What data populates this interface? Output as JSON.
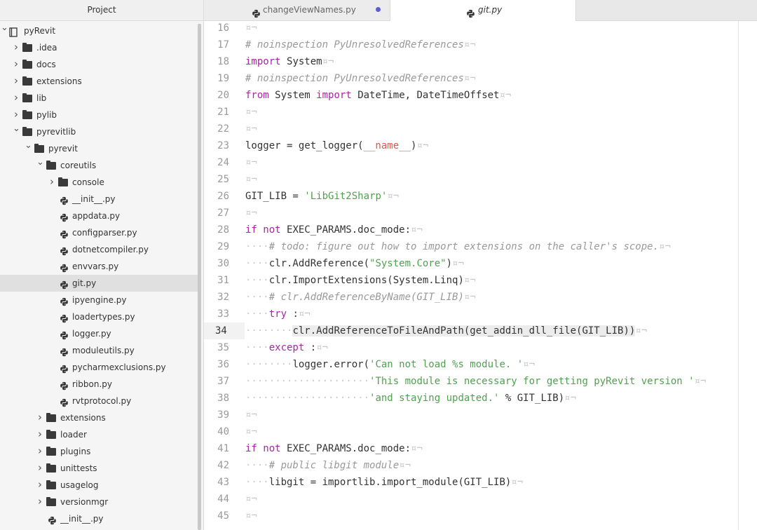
{
  "panel": {
    "title": "Project"
  },
  "tree": [
    {
      "label": "pyRevit",
      "type": "root",
      "depth": 0,
      "arrow": "open"
    },
    {
      "label": ".idea",
      "type": "folder",
      "depth": 1,
      "arrow": "closed"
    },
    {
      "label": "docs",
      "type": "folder",
      "depth": 1,
      "arrow": "closed"
    },
    {
      "label": "extensions",
      "type": "folder",
      "depth": 1,
      "arrow": "closed"
    },
    {
      "label": "lib",
      "type": "folder",
      "depth": 1,
      "arrow": "closed"
    },
    {
      "label": "pylib",
      "type": "folder",
      "depth": 1,
      "arrow": "closed"
    },
    {
      "label": "pyrevitlib",
      "type": "folder",
      "depth": 1,
      "arrow": "open"
    },
    {
      "label": "pyrevit",
      "type": "folder",
      "depth": 2,
      "arrow": "open"
    },
    {
      "label": "coreutils",
      "type": "folder",
      "depth": 3,
      "arrow": "open"
    },
    {
      "label": "console",
      "type": "folder",
      "depth": 4,
      "arrow": "closed"
    },
    {
      "label": "__init__.py",
      "type": "py",
      "depth": 4
    },
    {
      "label": "appdata.py",
      "type": "py",
      "depth": 4
    },
    {
      "label": "configparser.py",
      "type": "py",
      "depth": 4
    },
    {
      "label": "dotnetcompiler.py",
      "type": "py",
      "depth": 4
    },
    {
      "label": "envvars.py",
      "type": "py",
      "depth": 4
    },
    {
      "label": "git.py",
      "type": "py",
      "depth": 4,
      "selected": true
    },
    {
      "label": "ipyengine.py",
      "type": "py",
      "depth": 4
    },
    {
      "label": "loadertypes.py",
      "type": "py",
      "depth": 4
    },
    {
      "label": "logger.py",
      "type": "py",
      "depth": 4
    },
    {
      "label": "moduleutils.py",
      "type": "py",
      "depth": 4
    },
    {
      "label": "pycharmexclusions.py",
      "type": "py",
      "depth": 4
    },
    {
      "label": "ribbon.py",
      "type": "py",
      "depth": 4
    },
    {
      "label": "rvtprotocol.py",
      "type": "py",
      "depth": 4
    },
    {
      "label": "extensions",
      "type": "folder",
      "depth": 3,
      "arrow": "closed"
    },
    {
      "label": "loader",
      "type": "folder",
      "depth": 3,
      "arrow": "closed"
    },
    {
      "label": "plugins",
      "type": "folder",
      "depth": 3,
      "arrow": "closed"
    },
    {
      "label": "unittests",
      "type": "folder",
      "depth": 3,
      "arrow": "closed"
    },
    {
      "label": "usagelog",
      "type": "folder",
      "depth": 3,
      "arrow": "closed"
    },
    {
      "label": "versionmgr",
      "type": "folder",
      "depth": 3,
      "arrow": "closed"
    },
    {
      "label": "__init__.py",
      "type": "py",
      "depth": 3
    }
  ],
  "tabs": [
    {
      "label": "changeViewNames.py",
      "active": false,
      "modified": true
    },
    {
      "label": "git.py",
      "active": true,
      "modified": false
    }
  ],
  "editor": {
    "current_line": 34,
    "lines": [
      {
        "n": "16",
        "segs": [
          [
            "inv",
            "¤¬"
          ]
        ]
      },
      {
        "n": "17",
        "segs": [
          [
            "cm",
            "# noinspection PyUnresolvedReferences"
          ],
          [
            "inv",
            "¤¬"
          ]
        ]
      },
      {
        "n": "18",
        "segs": [
          [
            "kw",
            "import"
          ],
          [
            "",
            "System"
          ],
          [
            "inv",
            "¤¬"
          ]
        ]
      },
      {
        "n": "19",
        "segs": [
          [
            "cm",
            "# noinspection PyUnresolvedReferences"
          ],
          [
            "inv",
            "¤¬"
          ]
        ]
      },
      {
        "n": "20",
        "segs": [
          [
            "kw",
            "from"
          ],
          [
            "",
            "System"
          ],
          [
            "kw",
            "import"
          ],
          [
            "",
            "DateTime, DateTimeOffset"
          ],
          [
            "inv",
            "¤¬"
          ]
        ]
      },
      {
        "n": "21",
        "segs": [
          [
            "inv",
            "¤¬"
          ]
        ]
      },
      {
        "n": "22",
        "segs": [
          [
            "inv",
            "¤¬"
          ]
        ]
      },
      {
        "n": "23",
        "segs": [
          [
            "",
            "logger = get_logger("
          ],
          [
            "dunder",
            "__name__"
          ],
          [
            "",
            " )"
          ],
          [
            "inv",
            "¤¬"
          ]
        ]
      },
      {
        "n": "24",
        "segs": [
          [
            "inv",
            "¤¬"
          ]
        ]
      },
      {
        "n": "25",
        "segs": [
          [
            "inv",
            "¤¬"
          ]
        ]
      },
      {
        "n": "26",
        "segs": [
          [
            "",
            "GIT_LIB = "
          ],
          [
            "str",
            "'LibGit2Sharp'"
          ],
          [
            "inv",
            "¤¬"
          ]
        ]
      },
      {
        "n": "27",
        "segs": [
          [
            "inv",
            "¤¬"
          ]
        ]
      },
      {
        "n": "28",
        "segs": [
          [
            "kw",
            "if not"
          ],
          [
            "",
            "EXEC_PARAMS.doc_mode:"
          ],
          [
            "inv",
            "¤¬"
          ]
        ]
      },
      {
        "n": "29",
        "segs": [
          [
            "inv",
            "····"
          ],
          [
            "cm",
            "# todo: figure out how to import extensions on the caller's scope."
          ],
          [
            "inv",
            "¤¬"
          ]
        ]
      },
      {
        "n": "30",
        "segs": [
          [
            "inv",
            "····"
          ],
          [
            "",
            "clr.AddReference("
          ],
          [
            "str",
            "\"System.Core\""
          ],
          [
            "",
            ")"
          ],
          [
            "inv",
            "¤¬"
          ]
        ]
      },
      {
        "n": "31",
        "segs": [
          [
            "inv",
            "····"
          ],
          [
            "",
            "clr.ImportExtensions(System.Linq)"
          ],
          [
            "inv",
            "¤¬"
          ]
        ]
      },
      {
        "n": "32",
        "segs": [
          [
            "inv",
            "····"
          ],
          [
            "cm",
            "# clr.AddReferenceByName(GIT_LIB)"
          ],
          [
            "inv",
            "¤¬"
          ]
        ]
      },
      {
        "n": "33",
        "segs": [
          [
            "inv",
            "····"
          ],
          [
            "kw",
            "try"
          ],
          [
            "",
            ":"
          ],
          [
            "inv",
            "¤¬"
          ]
        ]
      },
      {
        "n": "34",
        "segs": [
          [
            "inv",
            "········"
          ],
          [
            "sel",
            "clr.AddReferenceToFileAndPath(get_addin_dll_file(GIT_LIB))"
          ],
          [
            "inv",
            "¤¬"
          ]
        ]
      },
      {
        "n": "35",
        "segs": [
          [
            "inv",
            "····"
          ],
          [
            "kw",
            "except"
          ],
          [
            "",
            ":"
          ],
          [
            "inv",
            "¤¬"
          ]
        ]
      },
      {
        "n": "36",
        "segs": [
          [
            "inv",
            "········"
          ],
          [
            "",
            "logger.error("
          ],
          [
            "str",
            "'Can not load %s module. '"
          ],
          [
            "inv",
            "¤¬"
          ]
        ]
      },
      {
        "n": "37",
        "segs": [
          [
            "inv",
            "·····················"
          ],
          [
            "str",
            "'This module is necessary for getting pyRevit version '"
          ],
          [
            "inv",
            "¤¬"
          ]
        ]
      },
      {
        "n": "38",
        "segs": [
          [
            "inv",
            "·····················"
          ],
          [
            "str",
            "'and staying updated.'"
          ],
          [
            "",
            " % GIT_LIB)"
          ],
          [
            "inv",
            "¤¬"
          ]
        ]
      },
      {
        "n": "39",
        "segs": [
          [
            "inv",
            "¤¬"
          ]
        ]
      },
      {
        "n": "40",
        "segs": [
          [
            "inv",
            "¤¬"
          ]
        ]
      },
      {
        "n": "41",
        "segs": [
          [
            "kw",
            "if not"
          ],
          [
            "",
            "EXEC_PARAMS.doc_mode:"
          ],
          [
            "inv",
            "¤¬"
          ]
        ]
      },
      {
        "n": "42",
        "segs": [
          [
            "inv",
            "····"
          ],
          [
            "cm",
            "# public libgit module"
          ],
          [
            "inv",
            "¤¬"
          ]
        ]
      },
      {
        "n": "43",
        "segs": [
          [
            "inv",
            "····"
          ],
          [
            "",
            "libgit = importlib.import_module(GIT_LIB)"
          ],
          [
            "inv",
            "¤¬"
          ]
        ]
      },
      {
        "n": "44",
        "segs": [
          [
            "inv",
            "¤¬"
          ]
        ]
      },
      {
        "n": "45",
        "segs": [
          [
            "inv",
            "¤¬"
          ]
        ]
      }
    ]
  },
  "colors": {
    "keyword": "#a626a4",
    "comment": "#999999",
    "string": "#50a14f",
    "dunder": "#e45649",
    "modified_dot": "#5b5bd6"
  },
  "icons": {
    "root": "book-icon",
    "folder": "folder-icon",
    "py": "python-file-icon",
    "arrow_open": "chevron-down-icon",
    "arrow_closed": "chevron-right-icon"
  }
}
